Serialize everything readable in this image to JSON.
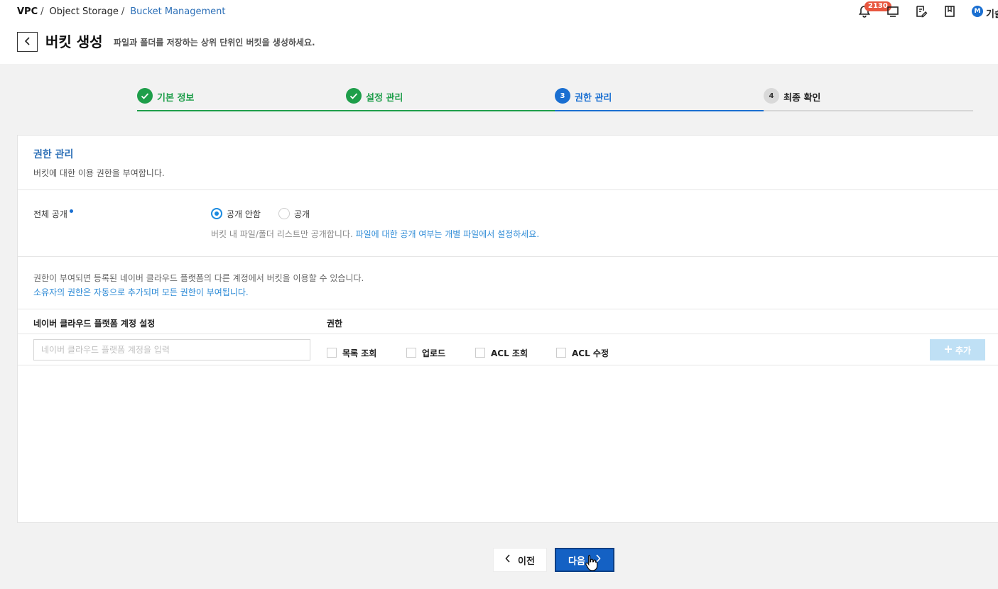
{
  "breadcrumb": {
    "item1": "VPC",
    "sep1": "/",
    "item2": "Object Storage",
    "sep2": "/",
    "item3": "Bucket Management"
  },
  "header": {
    "notification_count": "2130",
    "avatar_letter": "M",
    "user_name": "기술",
    "title": "버킷 생성",
    "description": "파일과 폴더를 저장하는 상위 단위인 버킷을 생성하세요."
  },
  "steps": [
    {
      "number": "1",
      "label": "기본 정보",
      "state": "done"
    },
    {
      "number": "2",
      "label": "설정 관리",
      "state": "done"
    },
    {
      "number": "3",
      "label": "권한 관리",
      "state": "active"
    },
    {
      "number": "4",
      "label": "최종 확인",
      "state": "pending"
    }
  ],
  "section": {
    "title": "권한 관리",
    "description": "버킷에 대한 이용 권한을 부여합니다."
  },
  "public_access": {
    "label": "전체 공개",
    "options": [
      {
        "label": "공개 안함",
        "selected": true
      },
      {
        "label": "공개",
        "selected": false
      }
    ],
    "hint": "버킷 내 파일/폴더 리스트만 공개합니다.",
    "hint_link": "파일에 대한 공개 여부는 개별 파일에서 설정하세요."
  },
  "permissions": {
    "info": "권한이 부여되면 등록된 네이버 클라우드 플랫폼의 다른 계정에서 버킷을 이용할 수 있습니다.",
    "info_highlight": "소유자의 권한은 자동으로 추가되며 모든 권한이 부여됩니다.",
    "col_account": "네이버 클라우드 플랫폼 계정 설정",
    "col_permission": "권한",
    "account_placeholder": "네이버 클라우드 플랫폼 계정을 입력",
    "account_value": "",
    "checkboxes": [
      {
        "label": "목록 조회",
        "checked": false
      },
      {
        "label": "업로드",
        "checked": false
      },
      {
        "label": "ACL 조회",
        "checked": false
      },
      {
        "label": "ACL 수정",
        "checked": false
      }
    ],
    "add_label": "추가"
  },
  "footer": {
    "prev_label": "이전",
    "next_label": "다음"
  },
  "colors": {
    "done": "#1e9e4a",
    "active": "#1a6fd1",
    "pending_bar": "#d6d6d6",
    "primary_button": "#1461c4",
    "link": "#2c8ad6"
  }
}
